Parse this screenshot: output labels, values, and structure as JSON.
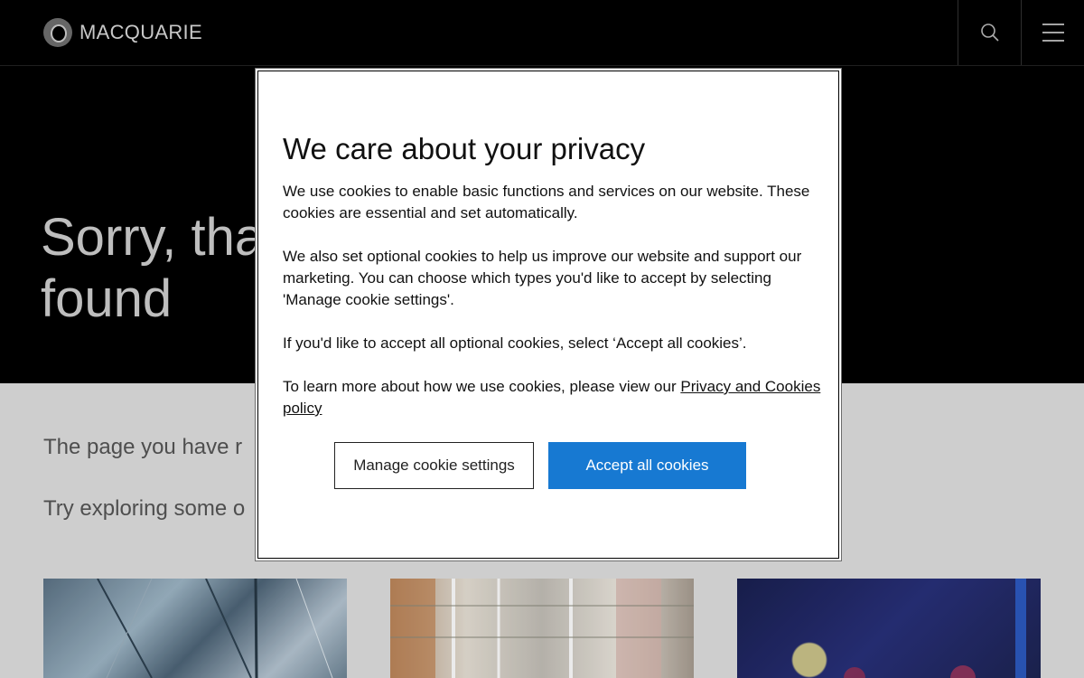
{
  "header": {
    "logo_text": "MACQUARIE",
    "search_icon": "search-icon",
    "menu_icon": "hamburger-menu-icon"
  },
  "hero": {
    "title_line1": "Sorry, tha",
    "title_line2": "found"
  },
  "content": {
    "line1": "The page you have r",
    "line2": "Try exploring some o"
  },
  "cards": [
    {
      "image": "blue-glass-building"
    },
    {
      "image": "office-atrium"
    },
    {
      "image": "blue-bokeh-lights"
    }
  ],
  "modal": {
    "title": "We care about your privacy",
    "p1": "We use cookies to enable basic functions and services on our website. These cookies are essential and set automatically.",
    "p2": "We also set optional cookies to help us improve our website and support our marketing. You can choose which types you'd like to accept by selecting 'Manage cookie settings'.",
    "p3": "If you'd like to accept all optional cookies, select ‘Accept all cookies’.",
    "p4_text": "To learn more about how we use cookies, please view our ",
    "p4_link": "Privacy and Cookies policy",
    "manage_label": "Manage cookie settings",
    "accept_label": "Accept all cookies",
    "accept_color": "#1779d2"
  }
}
